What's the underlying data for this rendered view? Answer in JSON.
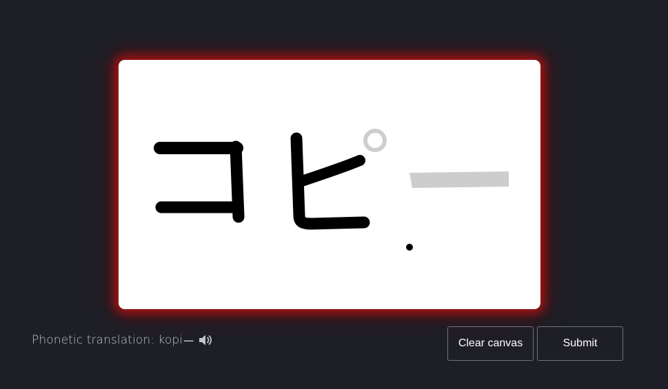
{
  "canvas": {
    "strokes": [
      {
        "role": "drawn",
        "char": "コ"
      },
      {
        "role": "drawn",
        "char": "ピ"
      },
      {
        "role": "hint",
        "char": "ー"
      }
    ]
  },
  "phonetic": {
    "label": "Phonetic translation:",
    "value": "kopi",
    "suffix": "ー"
  },
  "icons": {
    "audio": "speaker-icon"
  },
  "buttons": {
    "clear": "Clear canvas",
    "submit": "Submit"
  },
  "colors": {
    "background": "#1e1e26",
    "glow": "#aa1414",
    "ink": "#000000",
    "hint": "#cdcdcd",
    "text": "#c4c4cc"
  }
}
